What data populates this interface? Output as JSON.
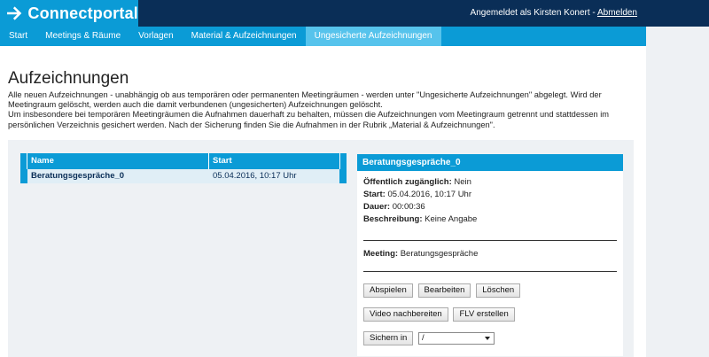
{
  "header": {
    "brand": "Connectportal",
    "logged_in_text": "Angemeldet als Kirsten Konert - ",
    "logout_label": "Abmelden"
  },
  "nav": {
    "items": [
      {
        "label": "Start"
      },
      {
        "label": "Meetings & Räume"
      },
      {
        "label": "Vorlagen"
      },
      {
        "label": "Material & Aufzeichnungen"
      },
      {
        "label": "Ungesicherte Aufzeichnungen"
      }
    ],
    "active_index": 4
  },
  "page": {
    "title": "Aufzeichnungen",
    "intro_1": "Alle neuen Aufzeichnungen - unabhängig ob aus temporären oder permanenten Meetingräumen - werden unter \"Ungesicherte Aufzeichnungen\" abgelegt. Wird der Meetingraum gelöscht, werden auch die damit verbundenen (ungesicherten) Aufzeichnungen gelöscht.",
    "intro_2": "Um insbesondere bei temporären Meetingräumen die Aufnahmen dauerhaft zu behalten, müssen die Aufzeichnungen vom Meetingraum getrennt und stattdessen im persönlichen Verzeichnis gesichert werden. Nach der Sicherung finden Sie die Aufnahmen in der Rubrik „Material & Aufzeichnungen\"."
  },
  "table": {
    "columns": {
      "name": "Name",
      "start": "Start"
    },
    "rows": [
      {
        "name": "Beratungsgespräche_0",
        "start": "05.04.2016, 10:17 Uhr"
      }
    ]
  },
  "detail": {
    "title": "Beratungsgespräche_0",
    "public_label": "Öffentlich zugänglich:",
    "public_value": "Nein",
    "start_label": "Start:",
    "start_value": "05.04.2016, 10:17 Uhr",
    "duration_label": "Dauer:",
    "duration_value": "00:00:36",
    "description_label": "Beschreibung:",
    "description_value": "Keine Angabe",
    "meeting_label": "Meeting:",
    "meeting_value": "Beratungsgespräche",
    "buttons": {
      "play": "Abspielen",
      "edit": "Bearbeiten",
      "delete": "Löschen",
      "edit_video": "Video nachbereiten",
      "create_flv": "FLV erstellen",
      "save_in": "Sichern in"
    },
    "folder_select_value": "/"
  },
  "colors": {
    "navy": "#0a2e57",
    "accent_blue": "#0b9bd6",
    "active_tab": "#56c3ec",
    "panel_bg": "#eef1f4"
  }
}
